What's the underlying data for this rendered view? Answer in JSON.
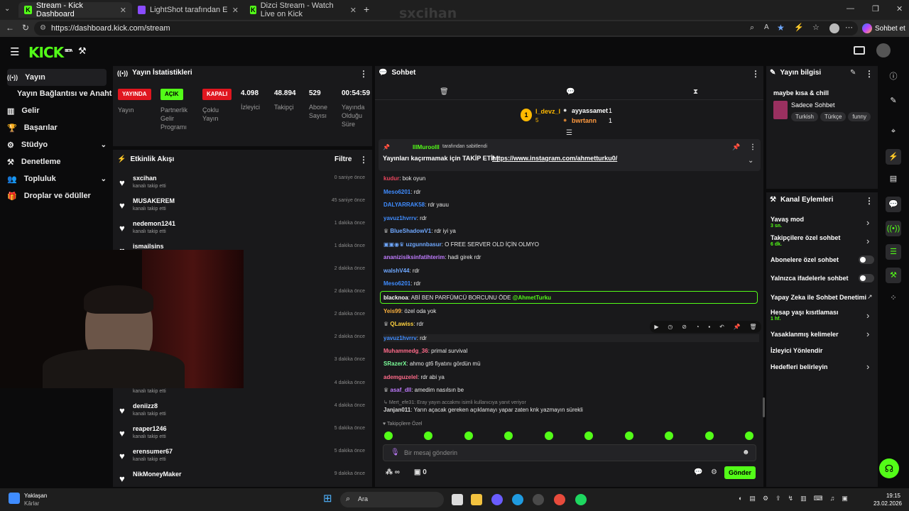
{
  "browser": {
    "tabs": [
      {
        "title": "Stream - Kick Dashboard",
        "icon": "kick-favicon"
      },
      {
        "title": "LightShot tarafından Ekran Görüntü",
        "icon": "lightshot-favicon"
      },
      {
        "title": "Dizci Stream - Watch Live on Kick",
        "icon": "kick-favicon"
      }
    ],
    "url": "https://dashboard.kick.com/stream",
    "watermark": "sxcihan",
    "profile_button": "Sohbet et"
  },
  "app": {
    "logo": "KICK",
    "beta": "BETA"
  },
  "sidebar": {
    "items": [
      {
        "label": "Yayın",
        "icon": "broadcast-icon"
      },
      {
        "label": "Yayın Bağlantısı ve Anahtarı",
        "icon": ""
      },
      {
        "label": "Gelir",
        "icon": "revenue-icon"
      },
      {
        "label": "Başarılar",
        "icon": "trophy-icon"
      },
      {
        "label": "Stüdyo",
        "icon": "studio-icon"
      },
      {
        "label": "Denetleme",
        "icon": "moderation-icon"
      },
      {
        "label": "Topluluk",
        "icon": "community-icon"
      },
      {
        "label": "Droplar ve ödüller",
        "icon": "drops-icon"
      }
    ]
  },
  "stats": {
    "title": "Yayın İstatistikleri",
    "badges": [
      {
        "text": "YAYINDA",
        "label": "Yayın",
        "color": "#e0161f"
      },
      {
        "text": "AÇIK",
        "label": "Partnerlik Gelir Programı",
        "color": "#53fc18"
      },
      {
        "text": "KAPALI",
        "label": "Çoklu Yayın",
        "color": "#e0161f"
      }
    ],
    "values": [
      {
        "value": "4.098",
        "label": "İzleyici"
      },
      {
        "value": "48.894",
        "label": "Takipçi"
      },
      {
        "value": "529",
        "label": "Abone Sayısı"
      },
      {
        "value": "00:54:59",
        "label": "Yayında Olduğu Süre"
      }
    ]
  },
  "activity": {
    "title": "Etkinlik Akışı",
    "filter": "Filtre",
    "items": [
      {
        "name": "sxcihan",
        "sub": "kanalı takip etti",
        "time": "0 saniye önce"
      },
      {
        "name": "MUSAKEREM",
        "sub": "kanalı takip etti",
        "time": "45 saniye önce"
      },
      {
        "name": "nedemon1241",
        "sub": "kanalı takip etti",
        "time": "1 dakika önce"
      },
      {
        "name": "ismailsins",
        "sub": "",
        "time": "1 dakika önce"
      },
      {
        "name": "",
        "sub": "",
        "time": "2 dakika önce"
      },
      {
        "name": "",
        "sub": "",
        "time": "2 dakika önce"
      },
      {
        "name": "",
        "sub": "",
        "time": "2 dakika önce"
      },
      {
        "name": "",
        "sub": "",
        "time": "2 dakika önce"
      },
      {
        "name": "",
        "sub": "",
        "time": "3 dakika önce"
      },
      {
        "name": "",
        "sub": "kanalı takip etti",
        "time": "4 dakika önce"
      },
      {
        "name": "deniizz8",
        "sub": "kanalı takip etti",
        "time": "4 dakika önce"
      },
      {
        "name": "reaper1246",
        "sub": "kanalı takip etti",
        "time": "5 dakika önce"
      },
      {
        "name": "erensumer67",
        "sub": "kanalı takip etti",
        "time": "5 dakika önce"
      },
      {
        "name": "NikMoneyMaker",
        "sub": "",
        "time": "9 dakika önce"
      }
    ]
  },
  "chat": {
    "title": "Sohbet",
    "leaderboard": [
      {
        "rank": "1",
        "name": "l_devz_l",
        "value": "5"
      },
      {
        "name": "ayyassamet",
        "value": "1"
      },
      {
        "name": "bwrtann",
        "value": "1"
      }
    ],
    "pinned": {
      "by": "IllMuroolll",
      "by_suffix": "tarafından sabitlendi",
      "text": "Yayınları kaçırmamak için TAKİP ETİ! |",
      "link": "https://www.instagram.com/ahmetturku0/"
    },
    "messages": [
      {
        "user": "kudur",
        "text": "bok oyun",
        "color": "#e8455d"
      },
      {
        "user": "Meso6201",
        "text": "rdr",
        "color": "#3f8cff"
      },
      {
        "user": "DALYARRAK58",
        "text": "rdr yauu",
        "color": "#3f8cff"
      },
      {
        "user": "yavuz1hvrrv",
        "text": "rdr",
        "color": "#3f8cff"
      },
      {
        "user": "BlueShadowV1",
        "text": "rdr iyi ya",
        "color": "#6fa8ff"
      },
      {
        "user": "uzgunnbasur",
        "text": "O FREE SERVER OLD İÇİN OLMYO",
        "color": "#6fa8ff"
      },
      {
        "user": "ananizisiksinfatihterim",
        "text": "hadi girek rdr",
        "color": "#c07cff"
      },
      {
        "user": "walshV44",
        "text": "rdr",
        "color": "#6fa8ff"
      },
      {
        "user": "Meso6201",
        "text": "rdr",
        "color": "#3f8cff"
      },
      {
        "user": "blacknoa",
        "text": "ABİ BEN PARFÜMCÜ BORCUNU ÖDE",
        "mention": "@AhmetTurku",
        "color": "#ffffff"
      },
      {
        "user": "Yeis99",
        "text": "özel oda yok",
        "color": "#ffb33f"
      },
      {
        "user": "QLawiss",
        "text": "rdr",
        "color": "#ffd23f"
      },
      {
        "user": "yavuz1hvrrv",
        "text": "rdr",
        "color": "#3f8cff"
      },
      {
        "user": "Muhammedg_36",
        "text": "primal survival",
        "color": "#ff6b8a"
      },
      {
        "user": "SRazerX",
        "text": "ahmo gt6 fiyatını gördün mü",
        "color": "#7cff9a"
      },
      {
        "user": "ademguzelel",
        "text": "rdr abi ya",
        "color": "#ff6b8a"
      },
      {
        "user": "asaf_dll",
        "text": "amedim nasılsın be",
        "color": "#c07cff"
      }
    ],
    "reply": {
      "hint": "Mert_efe31: Eray yayın accakmı isimli kullanıcıya yanıt veriyor",
      "user": "Janjan011",
      "text": "Yarın açacak gereken açıklamayı yapar zaten knk yazmayın sürekli"
    },
    "followers_only": "Takipçilere Özel",
    "input_placeholder": "Bir mesaj gönderin",
    "counter_a": "∞",
    "counter_b": "0",
    "send": "Gönder"
  },
  "stream_info": {
    "title": "Yayın bilgisi",
    "stream_title": "maybe kısa & chill",
    "category": "Sadece Sohbet",
    "tags": [
      "Turkish",
      "Türkçe",
      "funny"
    ]
  },
  "channel_actions": {
    "title": "Kanal Eylemleri",
    "items": [
      {
        "label": "Yavaş mod",
        "sub": "3 sn.",
        "control": "chevron"
      },
      {
        "label": "Takipçilere özel sohbet",
        "sub": "6 dk.",
        "control": "chevron"
      },
      {
        "label": "Abonelere özel sohbet",
        "sub": "",
        "control": "toggle"
      },
      {
        "label": "Yalnızca ifadelerle sohbet",
        "sub": "",
        "control": "toggle"
      },
      {
        "label": "Yapay Zeka ile Sohbet Denetimi",
        "sub": "",
        "control": "external"
      },
      {
        "label": "Hesap yaşı kısıtlaması",
        "sub": "1 hf.",
        "control": "chevron"
      },
      {
        "label": "Yasaklanmış kelimeler",
        "sub": "",
        "control": "chevron"
      },
      {
        "label": "İzleyici Yönlendir",
        "sub": "",
        "control": "none"
      },
      {
        "label": "Hedefleri belirleyin",
        "sub": "",
        "control": "chevron"
      }
    ]
  },
  "taskbar": {
    "weather_title": "Yaklaşan",
    "weather_sub": "Kârlar",
    "search": "Ara",
    "time": "19:15",
    "date": "23.02.2026"
  },
  "colors": {
    "accent": "#53fc18",
    "live": "#e0161f",
    "panel": "#19191b",
    "bg": "#0b0b0c"
  }
}
